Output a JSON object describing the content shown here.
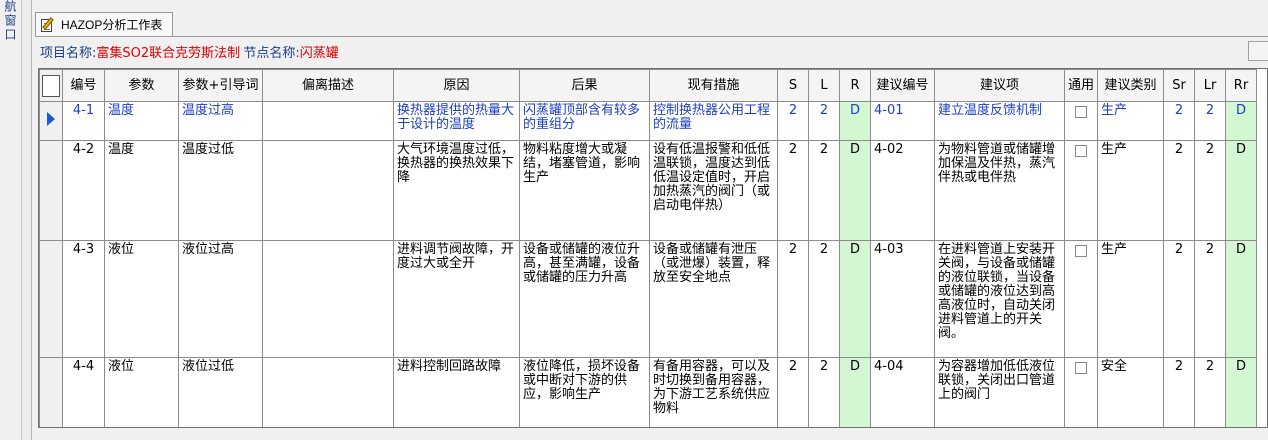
{
  "sidebar": {
    "nav_label": "航窗口"
  },
  "tab": {
    "label": "HAZOP分析工作表",
    "icon": "worksheet-edit-icon"
  },
  "info": {
    "project_label": "项目名称:",
    "project_value": "富集SO2联合克劳斯法制",
    "node_label": "节点名称:",
    "node_value": "闪蒸罐"
  },
  "colors": {
    "selected_text": "#1c3fc0",
    "label_blue": "#1c3f8c",
    "value_red": "#e00000",
    "risk_green": "#d3f7d3"
  },
  "table": {
    "headers": [
      "编号",
      "参数",
      "参数+引导词",
      "偏离描述",
      "原因",
      "后果",
      "现有措施",
      "S",
      "L",
      "R",
      "建议编号",
      "建议项",
      "通用",
      "建议类别",
      "Sr",
      "Lr",
      "Rr"
    ],
    "rows": [
      {
        "no": "4-1",
        "param": "温度",
        "guideword": "温度过高",
        "deviation": "",
        "cause": "换热器提供的热量大于设计的温度",
        "consequence": "闪蒸罐顶部含有较多的重组分",
        "measures": "控制换热器公用工程的流量",
        "s": "2",
        "l": "2",
        "r": "D",
        "sug_no": "4-01",
        "suggestion": "建立温度反馈机制",
        "common": false,
        "category": "生产",
        "sr": "2",
        "lr": "2",
        "rr": "D"
      },
      {
        "no": "4-2",
        "param": "温度",
        "guideword": "温度过低",
        "deviation": "",
        "cause": "大气环境温度过低，换热器的换热效果下降",
        "consequence": "物料粘度增大或凝结，堵塞管道，影响生产",
        "measures": "设有低温报警和低低温联锁，温度达到低低温设定值时，开启加热蒸汽的阀门（或启动电伴热）",
        "s": "2",
        "l": "2",
        "r": "D",
        "sug_no": "4-02",
        "suggestion": "为物料管道或储罐增加保温及伴热，蒸汽伴热或电伴热",
        "common": false,
        "category": "生产",
        "sr": "2",
        "lr": "2",
        "rr": "D"
      },
      {
        "no": "4-3",
        "param": "液位",
        "guideword": "液位过高",
        "deviation": "",
        "cause": "进料调节阀故障，开度过大或全开",
        "consequence": "设备或储罐的液位升高，甚至满罐，设备或储罐的压力升高",
        "measures": "设备或储罐有泄压（或泄爆）装置，释放至安全地点",
        "s": "2",
        "l": "2",
        "r": "D",
        "sug_no": "4-03",
        "suggestion": "在进料管道上安装开关阀，与设备或储罐的液位联锁，当设备或储罐的液位达到高高液位时，自动关闭进料管道上的开关阀。",
        "common": false,
        "category": "生产",
        "sr": "2",
        "lr": "2",
        "rr": "D"
      },
      {
        "no": "4-4",
        "param": "液位",
        "guideword": "液位过低",
        "deviation": "",
        "cause": "进料控制回路故障",
        "consequence": "液位降低，损坏设备或中断对下游的供应，影响生产",
        "measures": "有备用容器，可以及时切换到备用容器，为下游工艺系统供应物料",
        "s": "2",
        "l": "2",
        "r": "D",
        "sug_no": "4-04",
        "suggestion": "为容器增加低低液位联锁，关闭出口管道上的阀门",
        "common": false,
        "category": "安全",
        "sr": "2",
        "lr": "2",
        "rr": "D"
      }
    ]
  }
}
